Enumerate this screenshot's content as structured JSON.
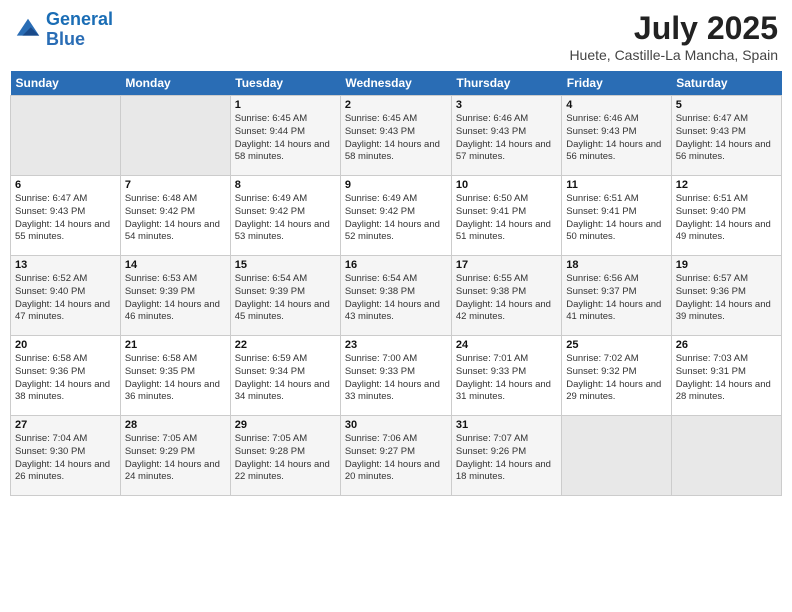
{
  "header": {
    "logo_line1": "General",
    "logo_line2": "Blue",
    "month_year": "July 2025",
    "location": "Huete, Castille-La Mancha, Spain"
  },
  "weekdays": [
    "Sunday",
    "Monday",
    "Tuesday",
    "Wednesday",
    "Thursday",
    "Friday",
    "Saturday"
  ],
  "weeks": [
    [
      {
        "day": "",
        "sunrise": "",
        "sunset": "",
        "daylight": ""
      },
      {
        "day": "",
        "sunrise": "",
        "sunset": "",
        "daylight": ""
      },
      {
        "day": "1",
        "sunrise": "Sunrise: 6:45 AM",
        "sunset": "Sunset: 9:44 PM",
        "daylight": "Daylight: 14 hours and 58 minutes."
      },
      {
        "day": "2",
        "sunrise": "Sunrise: 6:45 AM",
        "sunset": "Sunset: 9:43 PM",
        "daylight": "Daylight: 14 hours and 58 minutes."
      },
      {
        "day": "3",
        "sunrise": "Sunrise: 6:46 AM",
        "sunset": "Sunset: 9:43 PM",
        "daylight": "Daylight: 14 hours and 57 minutes."
      },
      {
        "day": "4",
        "sunrise": "Sunrise: 6:46 AM",
        "sunset": "Sunset: 9:43 PM",
        "daylight": "Daylight: 14 hours and 56 minutes."
      },
      {
        "day": "5",
        "sunrise": "Sunrise: 6:47 AM",
        "sunset": "Sunset: 9:43 PM",
        "daylight": "Daylight: 14 hours and 56 minutes."
      }
    ],
    [
      {
        "day": "6",
        "sunrise": "Sunrise: 6:47 AM",
        "sunset": "Sunset: 9:43 PM",
        "daylight": "Daylight: 14 hours and 55 minutes."
      },
      {
        "day": "7",
        "sunrise": "Sunrise: 6:48 AM",
        "sunset": "Sunset: 9:42 PM",
        "daylight": "Daylight: 14 hours and 54 minutes."
      },
      {
        "day": "8",
        "sunrise": "Sunrise: 6:49 AM",
        "sunset": "Sunset: 9:42 PM",
        "daylight": "Daylight: 14 hours and 53 minutes."
      },
      {
        "day": "9",
        "sunrise": "Sunrise: 6:49 AM",
        "sunset": "Sunset: 9:42 PM",
        "daylight": "Daylight: 14 hours and 52 minutes."
      },
      {
        "day": "10",
        "sunrise": "Sunrise: 6:50 AM",
        "sunset": "Sunset: 9:41 PM",
        "daylight": "Daylight: 14 hours and 51 minutes."
      },
      {
        "day": "11",
        "sunrise": "Sunrise: 6:51 AM",
        "sunset": "Sunset: 9:41 PM",
        "daylight": "Daylight: 14 hours and 50 minutes."
      },
      {
        "day": "12",
        "sunrise": "Sunrise: 6:51 AM",
        "sunset": "Sunset: 9:40 PM",
        "daylight": "Daylight: 14 hours and 49 minutes."
      }
    ],
    [
      {
        "day": "13",
        "sunrise": "Sunrise: 6:52 AM",
        "sunset": "Sunset: 9:40 PM",
        "daylight": "Daylight: 14 hours and 47 minutes."
      },
      {
        "day": "14",
        "sunrise": "Sunrise: 6:53 AM",
        "sunset": "Sunset: 9:39 PM",
        "daylight": "Daylight: 14 hours and 46 minutes."
      },
      {
        "day": "15",
        "sunrise": "Sunrise: 6:54 AM",
        "sunset": "Sunset: 9:39 PM",
        "daylight": "Daylight: 14 hours and 45 minutes."
      },
      {
        "day": "16",
        "sunrise": "Sunrise: 6:54 AM",
        "sunset": "Sunset: 9:38 PM",
        "daylight": "Daylight: 14 hours and 43 minutes."
      },
      {
        "day": "17",
        "sunrise": "Sunrise: 6:55 AM",
        "sunset": "Sunset: 9:38 PM",
        "daylight": "Daylight: 14 hours and 42 minutes."
      },
      {
        "day": "18",
        "sunrise": "Sunrise: 6:56 AM",
        "sunset": "Sunset: 9:37 PM",
        "daylight": "Daylight: 14 hours and 41 minutes."
      },
      {
        "day": "19",
        "sunrise": "Sunrise: 6:57 AM",
        "sunset": "Sunset: 9:36 PM",
        "daylight": "Daylight: 14 hours and 39 minutes."
      }
    ],
    [
      {
        "day": "20",
        "sunrise": "Sunrise: 6:58 AM",
        "sunset": "Sunset: 9:36 PM",
        "daylight": "Daylight: 14 hours and 38 minutes."
      },
      {
        "day": "21",
        "sunrise": "Sunrise: 6:58 AM",
        "sunset": "Sunset: 9:35 PM",
        "daylight": "Daylight: 14 hours and 36 minutes."
      },
      {
        "day": "22",
        "sunrise": "Sunrise: 6:59 AM",
        "sunset": "Sunset: 9:34 PM",
        "daylight": "Daylight: 14 hours and 34 minutes."
      },
      {
        "day": "23",
        "sunrise": "Sunrise: 7:00 AM",
        "sunset": "Sunset: 9:33 PM",
        "daylight": "Daylight: 14 hours and 33 minutes."
      },
      {
        "day": "24",
        "sunrise": "Sunrise: 7:01 AM",
        "sunset": "Sunset: 9:33 PM",
        "daylight": "Daylight: 14 hours and 31 minutes."
      },
      {
        "day": "25",
        "sunrise": "Sunrise: 7:02 AM",
        "sunset": "Sunset: 9:32 PM",
        "daylight": "Daylight: 14 hours and 29 minutes."
      },
      {
        "day": "26",
        "sunrise": "Sunrise: 7:03 AM",
        "sunset": "Sunset: 9:31 PM",
        "daylight": "Daylight: 14 hours and 28 minutes."
      }
    ],
    [
      {
        "day": "27",
        "sunrise": "Sunrise: 7:04 AM",
        "sunset": "Sunset: 9:30 PM",
        "daylight": "Daylight: 14 hours and 26 minutes."
      },
      {
        "day": "28",
        "sunrise": "Sunrise: 7:05 AM",
        "sunset": "Sunset: 9:29 PM",
        "daylight": "Daylight: 14 hours and 24 minutes."
      },
      {
        "day": "29",
        "sunrise": "Sunrise: 7:05 AM",
        "sunset": "Sunset: 9:28 PM",
        "daylight": "Daylight: 14 hours and 22 minutes."
      },
      {
        "day": "30",
        "sunrise": "Sunrise: 7:06 AM",
        "sunset": "Sunset: 9:27 PM",
        "daylight": "Daylight: 14 hours and 20 minutes."
      },
      {
        "day": "31",
        "sunrise": "Sunrise: 7:07 AM",
        "sunset": "Sunset: 9:26 PM",
        "daylight": "Daylight: 14 hours and 18 minutes."
      },
      {
        "day": "",
        "sunrise": "",
        "sunset": "",
        "daylight": ""
      },
      {
        "day": "",
        "sunrise": "",
        "sunset": "",
        "daylight": ""
      }
    ]
  ]
}
